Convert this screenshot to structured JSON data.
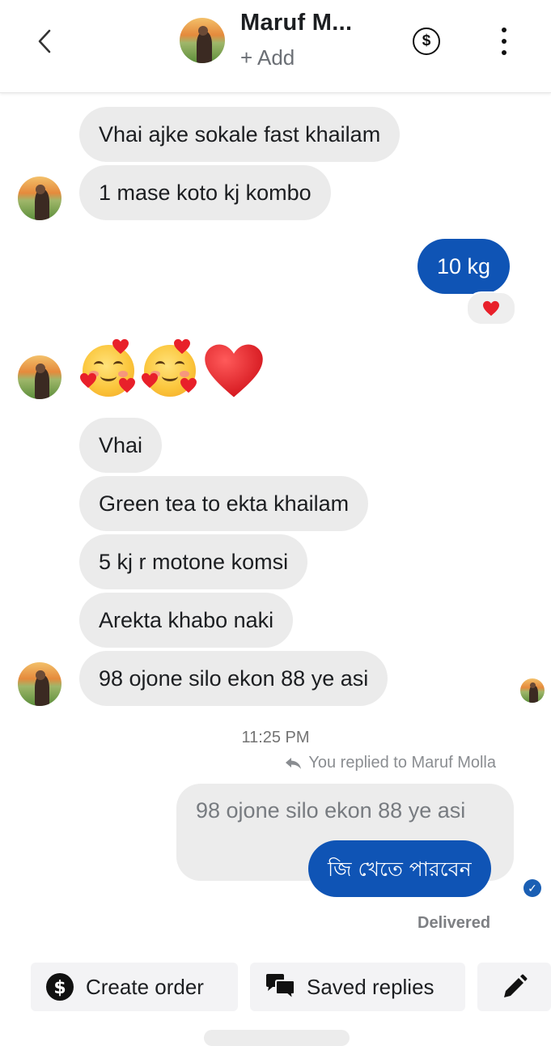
{
  "header": {
    "contact_name": "Maruf M...",
    "add_label": "+ Add"
  },
  "messages": {
    "m1": "Vhai ajke sokale fast khailam",
    "m2": "1 mase koto kj kombo",
    "m3": "10 kg",
    "m5": "Vhai",
    "m6": "Green tea to ekta khailam",
    "m7": "5 kj r motone komsi",
    "m8": "Arekta khabo naki",
    "m9": "98 ojone silo ekon 88 ye asi"
  },
  "meta": {
    "timestamp": "11:25 PM",
    "replied_label": "You replied to Maruf Molla",
    "quoted_text": "98 ojone silo ekon 88 ye asi",
    "reply_text": "জি খেতে পারবেন",
    "status": "Delivered"
  },
  "actions": {
    "create_order": "Create order",
    "saved_replies": "Saved replies"
  },
  "icons": {
    "back": "chevron-left-icon",
    "payment": "dollar-circle-icon",
    "more": "more-vertical-icon",
    "edit": "pencil-icon",
    "saved_replies": "chat-bubbles-icon",
    "reply": "reply-arrow-icon"
  },
  "colors": {
    "outgoing_bubble": "#0f54b5",
    "incoming_bubble": "#ebebeb",
    "heart": "#e8202a"
  }
}
